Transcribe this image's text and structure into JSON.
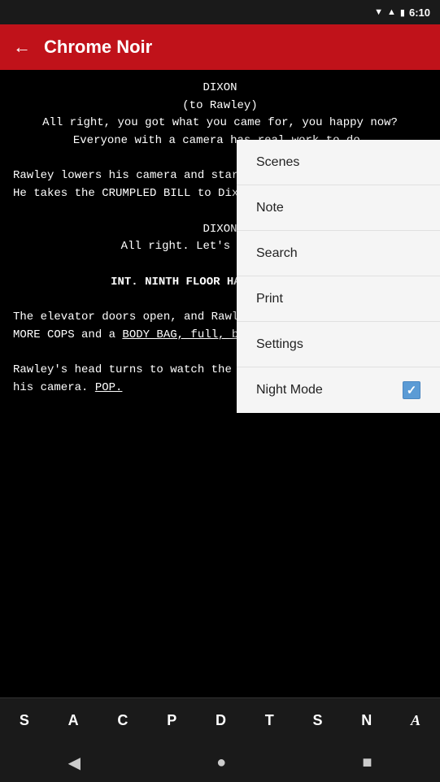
{
  "statusBar": {
    "time": "6:10",
    "icons": [
      "signal",
      "wifi",
      "battery"
    ]
  },
  "appBar": {
    "title": "Chrome Noir",
    "backLabel": "←"
  },
  "dropdown": {
    "items": [
      {
        "id": "scenes",
        "label": "Scenes",
        "hasCheckbox": false
      },
      {
        "id": "note",
        "label": "Note",
        "hasCheckbox": false
      },
      {
        "id": "search",
        "label": "Search",
        "hasCheckbox": false
      },
      {
        "id": "print",
        "label": "Print",
        "hasCheckbox": false
      },
      {
        "id": "settings",
        "label": "Settings",
        "hasCheckbox": false
      },
      {
        "id": "night-mode",
        "label": "Night Mode",
        "hasCheckbox": true,
        "checked": true
      }
    ]
  },
  "mainContent": {
    "paragraph1": "DIXON",
    "paragraph1b": "(to Rawley)",
    "paragraph2": "All right, you got what you came for, you happy now? Everyone with a camera has real work to do.",
    "paragraph3": "Rawley lowers his camera and stares at the mechanical body. He takes the CRUMPLED BILL to Dixon's hand and pockets it.",
    "paragraph4": "DIXON",
    "paragraph5": "All right. Let's go upstairs.",
    "sceneHeading": "INT. NINTH FLOOR HALLWAY - NIGHT",
    "paragraph6": "The elevator doors open, and Rawley follows Dixon out, past MORE COPS and a BODY BAG, full, being taken out on a gurney.",
    "paragraph7": "Rawley's head turns to watch the gurney roll by. He raises his camera. POP."
  },
  "bottomToolbar": {
    "buttons": [
      {
        "id": "S",
        "label": "S"
      },
      {
        "id": "A",
        "label": "A"
      },
      {
        "id": "C",
        "label": "C"
      },
      {
        "id": "P",
        "label": "P"
      },
      {
        "id": "D",
        "label": "D"
      },
      {
        "id": "T",
        "label": "T"
      },
      {
        "id": "S2",
        "label": "S"
      },
      {
        "id": "N",
        "label": "N"
      },
      {
        "id": "italic-A",
        "label": "A",
        "italic": true
      }
    ]
  },
  "navBar": {
    "buttons": [
      {
        "id": "back",
        "label": "◀"
      },
      {
        "id": "home",
        "label": "●"
      },
      {
        "id": "recent",
        "label": "■"
      }
    ]
  }
}
